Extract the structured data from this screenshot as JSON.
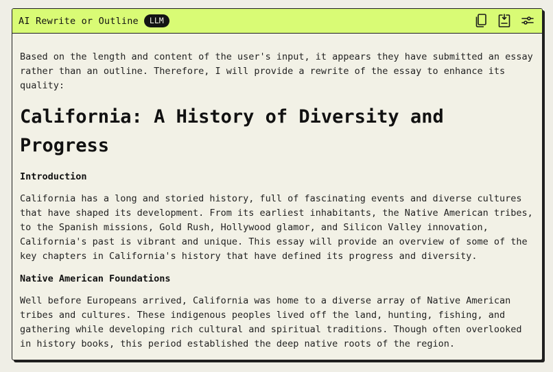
{
  "header": {
    "title": "AI Rewrite or Outline",
    "badge": "LLM",
    "icons": [
      "copy-icon",
      "insert-icon",
      "settings-sliders-icon"
    ]
  },
  "content": {
    "intro": "Based on the length and content of the user's input, it appears they have submitted an essay rather than an outline. Therefore, I will provide a rewrite of the essay to enhance its quality:",
    "heading": "California: A History of Diversity and Progress",
    "sections": [
      {
        "title": "Introduction",
        "body": "California has a long and storied history, full of fascinating events and diverse cultures that have shaped its development. From its earliest inhabitants, the Native American tribes, to the Spanish missions, Gold Rush, Hollywood glamor, and Silicon Valley innovation, California's past is vibrant and unique. This essay will provide an overview of some of the key chapters in California's history that have defined its progress and diversity."
      },
      {
        "title": "Native American Foundations",
        "body": "Well before Europeans arrived, California was home to a diverse array of Native American tribes and cultures. These indigenous peoples lived off the land, hunting, fishing, and gathering while developing rich cultural and spiritual traditions. Though often overlooked in history books, this period established the deep native roots of the region."
      }
    ]
  }
}
